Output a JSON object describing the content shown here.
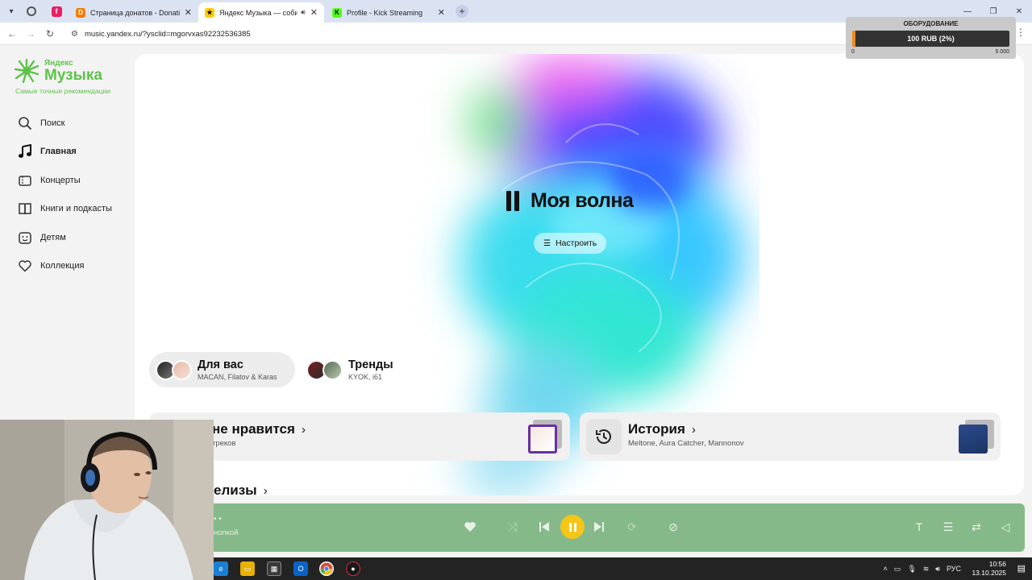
{
  "browser": {
    "tabs": [
      {
        "title": "Страница донатов - DonationAlerts",
        "active": false
      },
      {
        "title": "Яндекс Музыка — собираем музыку для вас",
        "active": true
      },
      {
        "title": "Profile - Kick Streaming",
        "active": false
      }
    ],
    "url": "music.yandex.ru/?ysclid=mgorvxas92232536385",
    "close_glyph": "✕",
    "new_tab_glyph": "+",
    "window_controls": [
      "—",
      "❐",
      "✕"
    ]
  },
  "donation_goal": {
    "title": "ОБОРУДОВАНИЕ",
    "progress_text": "100 RUB (2%)",
    "progress_fraction": 0.02,
    "min": "0",
    "max": "5 000",
    "fill_color": "#f08a1c"
  },
  "sidebar": {
    "brand_small": "Яндекс",
    "brand_big": "Музыка",
    "tagline": "Самые точные рекомендации",
    "items": [
      {
        "label": "Поиск",
        "icon": "search-icon",
        "active": false
      },
      {
        "label": "Главная",
        "icon": "music-note-icon",
        "active": true
      },
      {
        "label": "Концерты",
        "icon": "ticket-icon",
        "active": false
      },
      {
        "label": "Книги и подкасты",
        "icon": "book-icon",
        "active": false
      },
      {
        "label": "Детям",
        "icon": "kids-icon",
        "active": false
      },
      {
        "label": "Коллекция",
        "icon": "heart-icon",
        "active": false
      }
    ]
  },
  "main": {
    "wave_title": "Моя волна",
    "tune_label": "Настроить",
    "chips": [
      {
        "title": "Для вас",
        "subtitle": "MACAN, Filatov & Karas"
      },
      {
        "title": "Тренды",
        "subtitle": "KYOK, i61"
      }
    ],
    "cards": [
      {
        "title": "не нравится",
        "subtitle": "треков"
      },
      {
        "title": "История",
        "subtitle": "Meltone, Aura Catcher, Mannonov"
      }
    ],
    "releases_title": "елизы",
    "chevron": "›"
  },
  "player": {
    "track_dots": "• •",
    "track_subtitle": "нопкой"
  },
  "taskbar": {
    "lang": "РУС",
    "time": "10:56",
    "date": "13.10.2025"
  }
}
